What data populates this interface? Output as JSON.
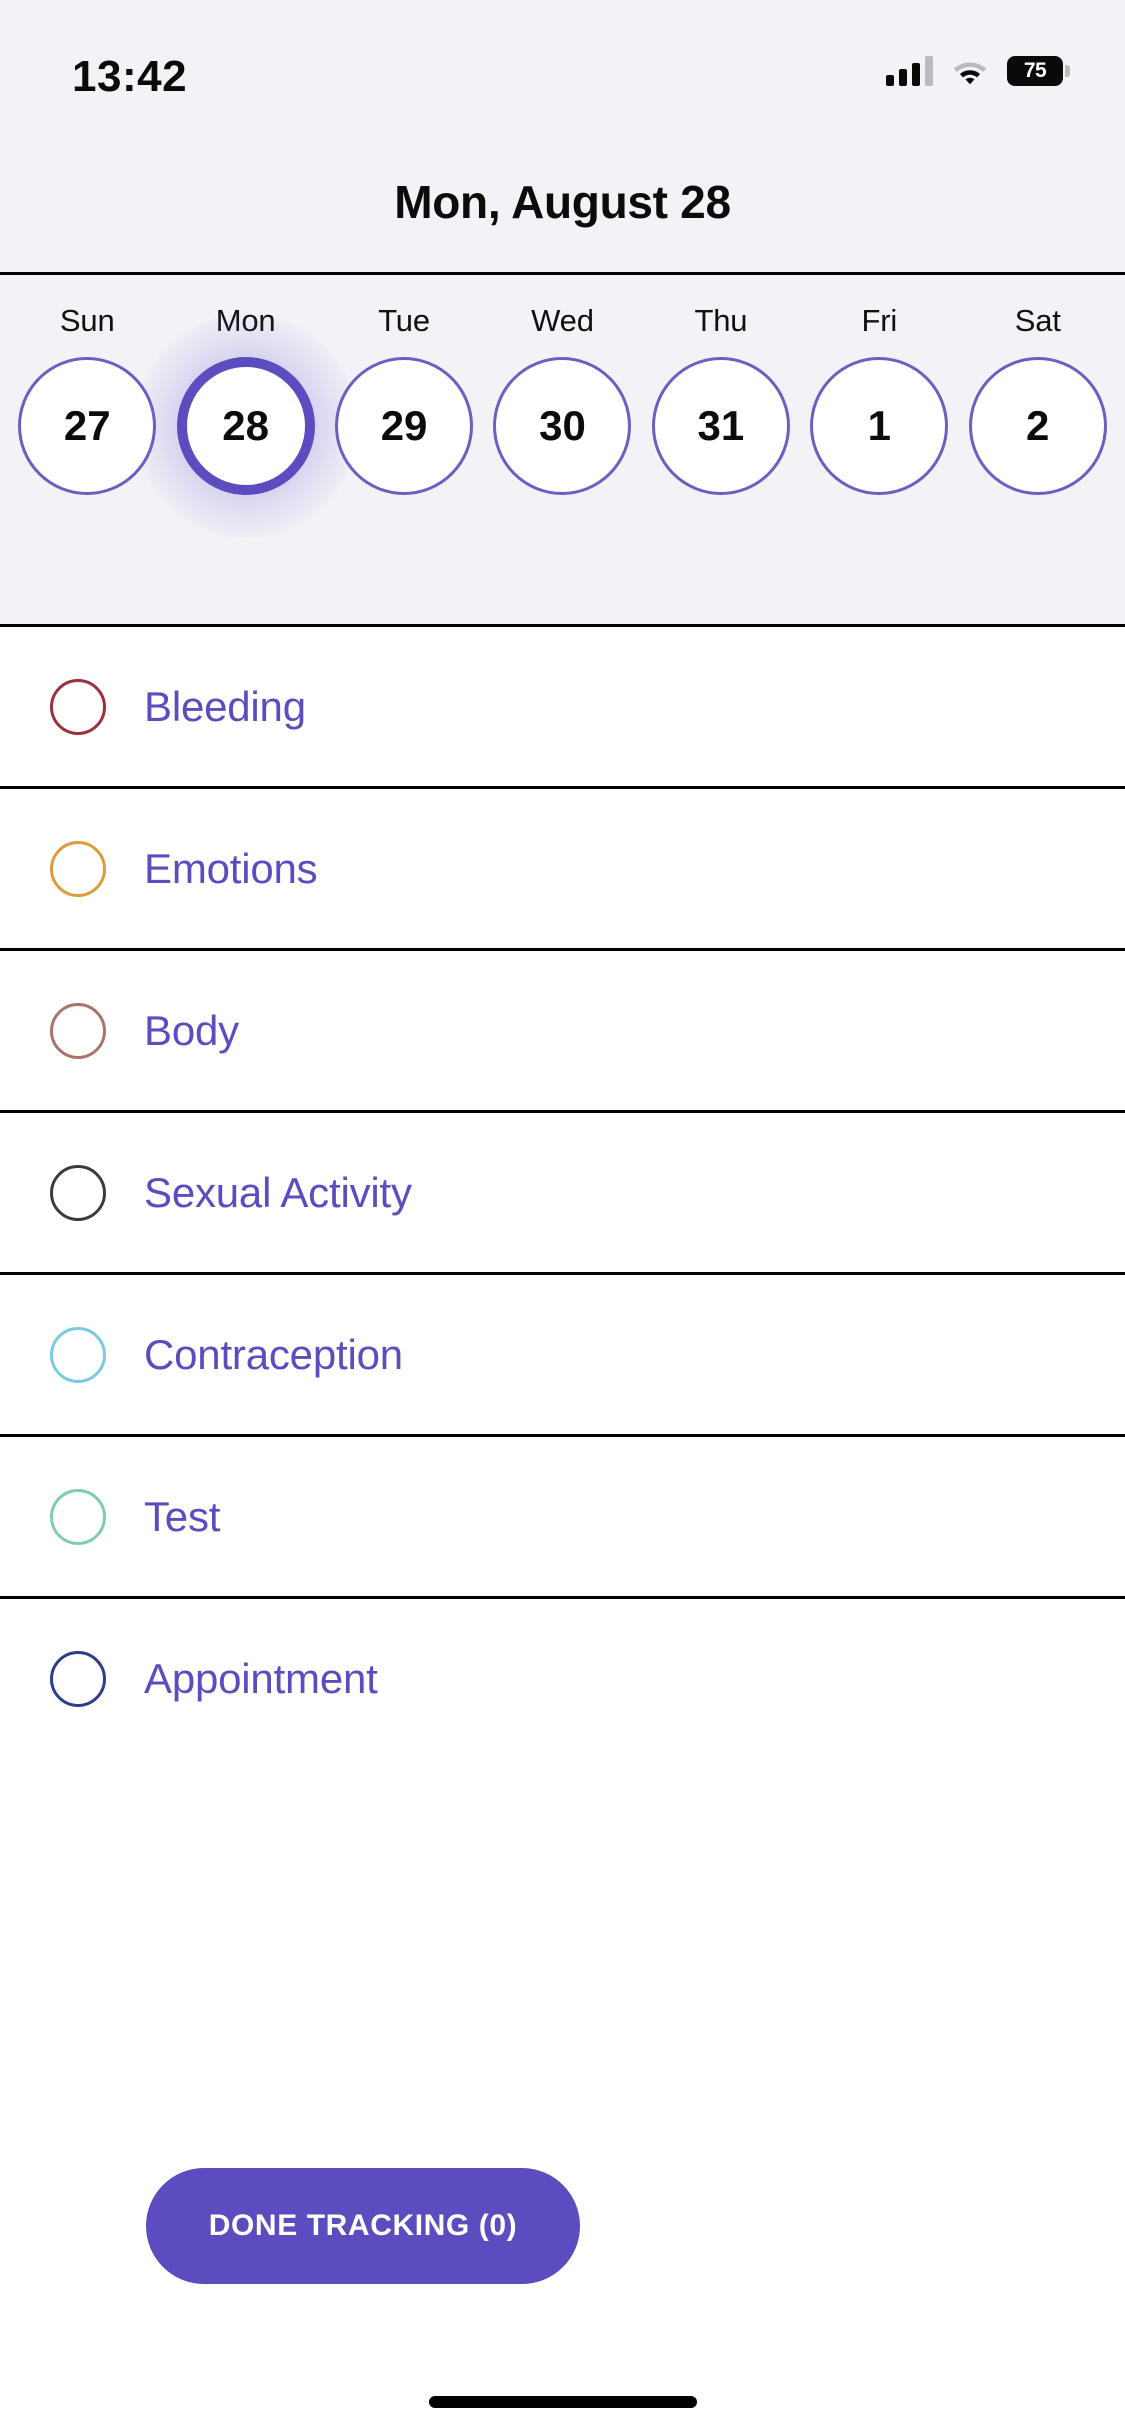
{
  "status_bar": {
    "time": "13:42",
    "battery_level": "75",
    "cellular_icon": "signal-bars-icon",
    "wifi_icon": "wifi-icon",
    "battery_icon": "battery-icon"
  },
  "header": {
    "title": "Mon, August 28"
  },
  "week_strip": {
    "days": [
      {
        "name": "Sun",
        "number": "27",
        "selected": false
      },
      {
        "name": "Mon",
        "number": "28",
        "selected": true
      },
      {
        "name": "Tue",
        "number": "29",
        "selected": false
      },
      {
        "name": "Wed",
        "number": "30",
        "selected": false
      },
      {
        "name": "Thu",
        "number": "31",
        "selected": false
      },
      {
        "name": "Fri",
        "number": "1",
        "selected": false
      },
      {
        "name": "Sat",
        "number": "2",
        "selected": false
      }
    ],
    "accent_color": "#6B5FC0",
    "selected_color": "#5B4CC0"
  },
  "tracking_list": {
    "items": [
      {
        "label": "Bleeding",
        "circle_color": "#9E2F3C"
      },
      {
        "label": "Emotions",
        "circle_color": "#E09A3E"
      },
      {
        "label": "Body",
        "circle_color": "#A9756B"
      },
      {
        "label": "Sexual Activity",
        "circle_color": "#3C3C3C"
      },
      {
        "label": "Contraception",
        "circle_color": "#7BCBE0"
      },
      {
        "label": "Test",
        "circle_color": "#7ECFA8"
      },
      {
        "label": "Appointment",
        "circle_color": "#2A3E8C"
      }
    ],
    "label_color": "#5B4CC0"
  },
  "footer": {
    "done_button_label": "DONE TRACKING (0)",
    "done_button_color": "#5B4CC0"
  }
}
